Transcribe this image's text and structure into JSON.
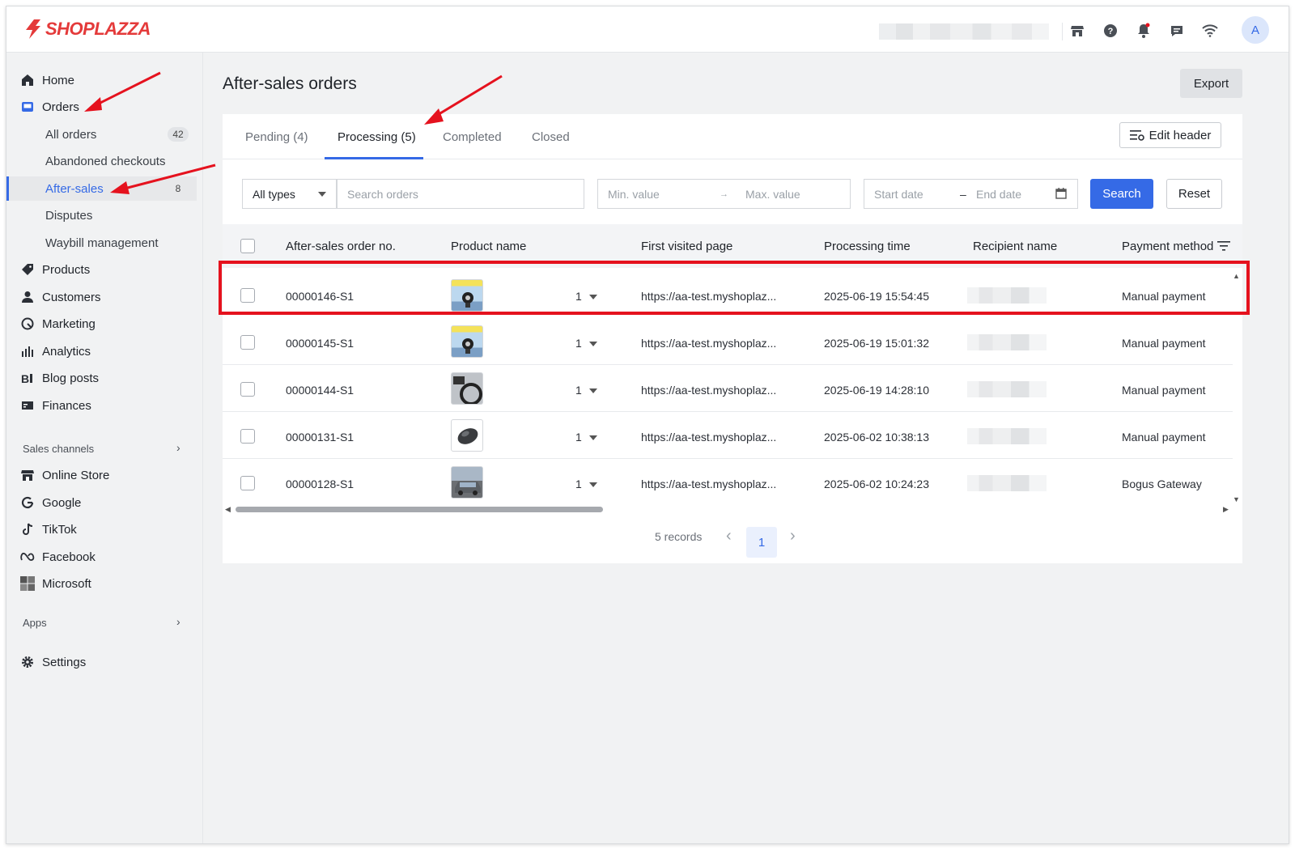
{
  "brand": {
    "name": "SHOPLAZZA",
    "color": "#e43a3a"
  },
  "topbar": {
    "icons": [
      "store-icon",
      "help-icon",
      "bell-icon",
      "chat-icon",
      "wifi-icon"
    ],
    "avatar_letter": "A"
  },
  "sidebar": {
    "items": [
      {
        "label": "Home",
        "icon": "home-icon"
      },
      {
        "label": "Orders",
        "icon": "orders-icon"
      },
      {
        "label": "Products",
        "icon": "tag-icon"
      },
      {
        "label": "Customers",
        "icon": "person-icon"
      },
      {
        "label": "Marketing",
        "icon": "marketing-icon"
      },
      {
        "label": "Analytics",
        "icon": "bar-chart-icon"
      },
      {
        "label": "Blog posts",
        "icon": "blog-icon"
      },
      {
        "label": "Finances",
        "icon": "finance-icon"
      }
    ],
    "order_subitems": [
      {
        "label": "All orders",
        "badge": "42"
      },
      {
        "label": "Abandoned checkouts",
        "badge": ""
      },
      {
        "label": "After-sales",
        "badge": "8"
      },
      {
        "label": "Disputes",
        "badge": ""
      },
      {
        "label": "Waybill management",
        "badge": ""
      }
    ],
    "sales_channels_label": "Sales channels",
    "channels": [
      {
        "label": "Online Store",
        "icon": "store-icon"
      },
      {
        "label": "Google",
        "icon": "google-icon"
      },
      {
        "label": "TikTok",
        "icon": "tiktok-icon"
      },
      {
        "label": "Facebook",
        "icon": "meta-icon"
      },
      {
        "label": "Microsoft",
        "icon": "microsoft-icon"
      }
    ],
    "apps_label": "Apps",
    "settings_label": "Settings"
  },
  "main": {
    "title": "After-sales orders",
    "export_label": "Export",
    "tabs": [
      {
        "label": "Pending  (4)"
      },
      {
        "label": "Processing  (5)"
      },
      {
        "label": "Completed"
      },
      {
        "label": "Closed"
      }
    ],
    "active_tab": "Processing  (5)",
    "edit_header_label": "Edit header",
    "filters": {
      "type_select": "All types",
      "search_placeholder": "Search orders",
      "min_placeholder": "Min. value",
      "max_placeholder": "Max. value",
      "start_placeholder": "Start date",
      "end_placeholder": "End date",
      "search_label": "Search",
      "reset_label": "Reset"
    },
    "table": {
      "columns": [
        "After-sales order no.",
        "Product name",
        "First visited page",
        "Processing time",
        "Recipient name",
        "Payment method"
      ],
      "rows": [
        {
          "order_no": "00000146-S1",
          "qty": "1",
          "page": "https://aa-test.myshoplaz...",
          "time": "2025-06-19 15:54:45",
          "payment": "Manual payment",
          "thumb": "phone-holder"
        },
        {
          "order_no": "00000145-S1",
          "qty": "1",
          "page": "https://aa-test.myshoplaz...",
          "time": "2025-06-19 15:01:32",
          "payment": "Manual payment",
          "thumb": "phone-holder"
        },
        {
          "order_no": "00000144-S1",
          "qty": "1",
          "page": "https://aa-test.myshoplaz...",
          "time": "2025-06-19 14:28:10",
          "payment": "Manual payment",
          "thumb": "car-interior"
        },
        {
          "order_no": "00000131-S1",
          "qty": "1",
          "page": "https://aa-test.myshoplaz...",
          "time": "2025-06-02 10:38:13",
          "payment": "Manual payment",
          "thumb": "mouse"
        },
        {
          "order_no": "00000128-S1",
          "qty": "1",
          "page": "https://aa-test.myshoplaz...",
          "time": "2025-06-02 10:24:23",
          "payment": "Bogus Gateway",
          "thumb": "car"
        }
      ]
    },
    "pagination": {
      "records": "5 records",
      "current_page": "1"
    }
  },
  "colors": {
    "accent": "#356ae6",
    "highlight": "#e5121e"
  }
}
